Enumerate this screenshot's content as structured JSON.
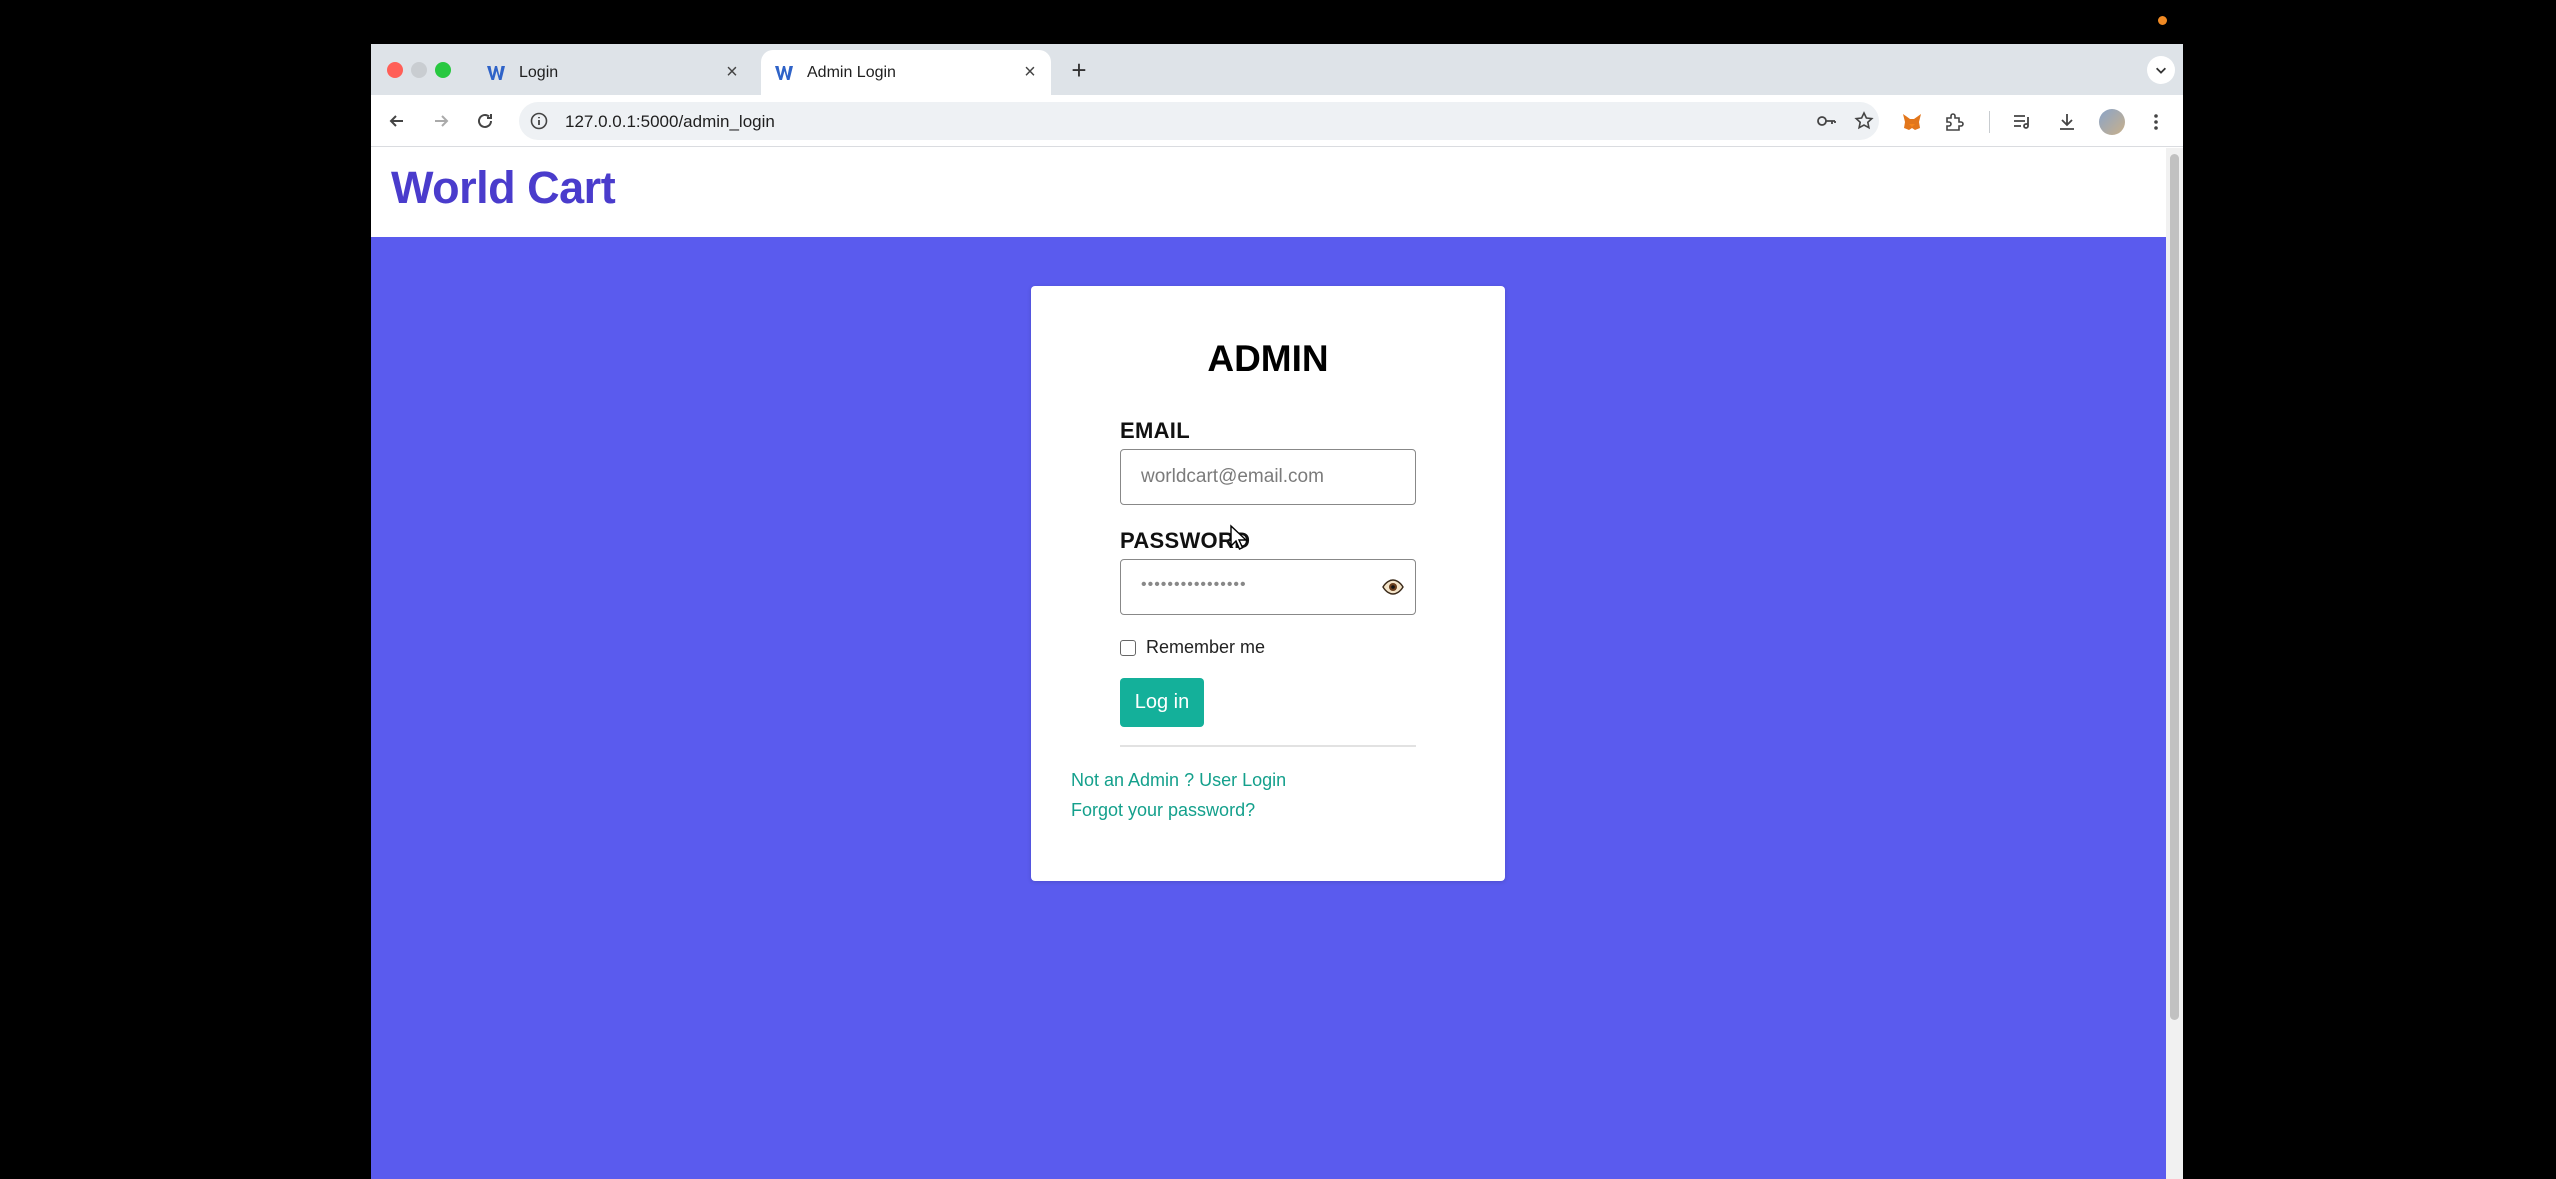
{
  "browser": {
    "tabs": [
      {
        "title": "Login",
        "favicon": "worldcart-w-icon"
      },
      {
        "title": "Admin Login",
        "favicon": "worldcart-w-icon",
        "active": true
      }
    ],
    "url": "127.0.0.1:5000/admin_login",
    "new_tab_icon": "plus-icon"
  },
  "site": {
    "brand": "World Cart",
    "brand_color": "#4a3ccc",
    "background_color": "#5a5bee",
    "accent_color": "#14b09a"
  },
  "login_form": {
    "title": "ADMIN",
    "email_label": "EMAIL",
    "email_placeholder": "worldcart@email.com",
    "password_label": "PASSWORD",
    "password_mask": "••••••••••••••••",
    "remember_label": "Remember me",
    "remember_checked": false,
    "submit_label": "Log in",
    "links": {
      "user_login": "Not an Admin ? User Login",
      "forgot_password": "Forgot your password?"
    }
  }
}
